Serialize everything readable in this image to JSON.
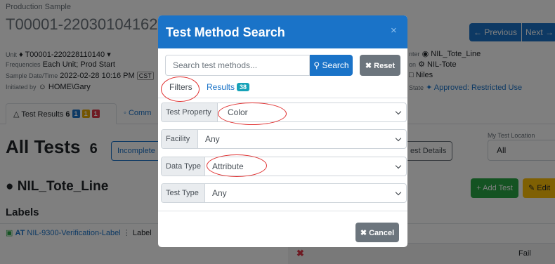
{
  "background": {
    "sample_type": "Production Sample",
    "sample_id": "T00001-22030104162",
    "unit_label": "Unit",
    "unit_value": "T00001-220228110140",
    "frequencies_label": "Frequencies",
    "frequencies_value": "Each Unit; Prod Start",
    "sample_date_label": "Sample Date/Time",
    "sample_date_value": "2022-02-28 10:16 PM",
    "timezone": "CST",
    "initiated_label": "Initiated by",
    "initiated_value": "HOME\\Gary",
    "location_partial": "nter",
    "location_value": "NIL_Tote_Line",
    "on_partial": "on",
    "on_value": "NIL-Tote",
    "plant_value": "Niles",
    "state_partial": "State",
    "state_value": "Approved: Restricted Use",
    "prev_button": "Previous",
    "next_button": "Next",
    "tab_results_label": "Test Results",
    "tab_results_count": "6",
    "tab_results_badges": [
      "1",
      "1",
      "1"
    ],
    "tab_comments_label": "Comm",
    "all_tests_title": "All Tests",
    "all_tests_count": "6",
    "incomplete_button": "Incomplete",
    "test_details_button": "est Details",
    "my_location_label": "My Test Location",
    "my_location_value": "All",
    "section_location": "NIL_Tote_Line",
    "add_test_button": "Add Test",
    "edit_button": "Edit",
    "labels_heading": "Labels",
    "label_row_prefix": "AT",
    "label_row_link": "NIL-9300-Verification-Label",
    "label_row_suffix": "Label",
    "fail_text": "Fail"
  },
  "modal": {
    "title": "Test Method Search",
    "close": "×",
    "search_placeholder": "Search test methods...",
    "search_button": "Search",
    "reset_button": "Reset",
    "tab_filters": "Filters",
    "tab_results": "Results",
    "results_count": "38",
    "filters": [
      {
        "label": "Test Property",
        "value": "Color"
      },
      {
        "label": "Facility",
        "value": "Any"
      },
      {
        "label": "Data Type",
        "value": "Attribute"
      },
      {
        "label": "Test Type",
        "value": "Any"
      }
    ],
    "cancel_button": "Cancel"
  },
  "colors": {
    "primary": "#1a73c8",
    "secondary": "#6c757d",
    "success": "#28a745",
    "warning": "#ffc107",
    "info": "#17a2b8",
    "annotation": "#e03030"
  }
}
